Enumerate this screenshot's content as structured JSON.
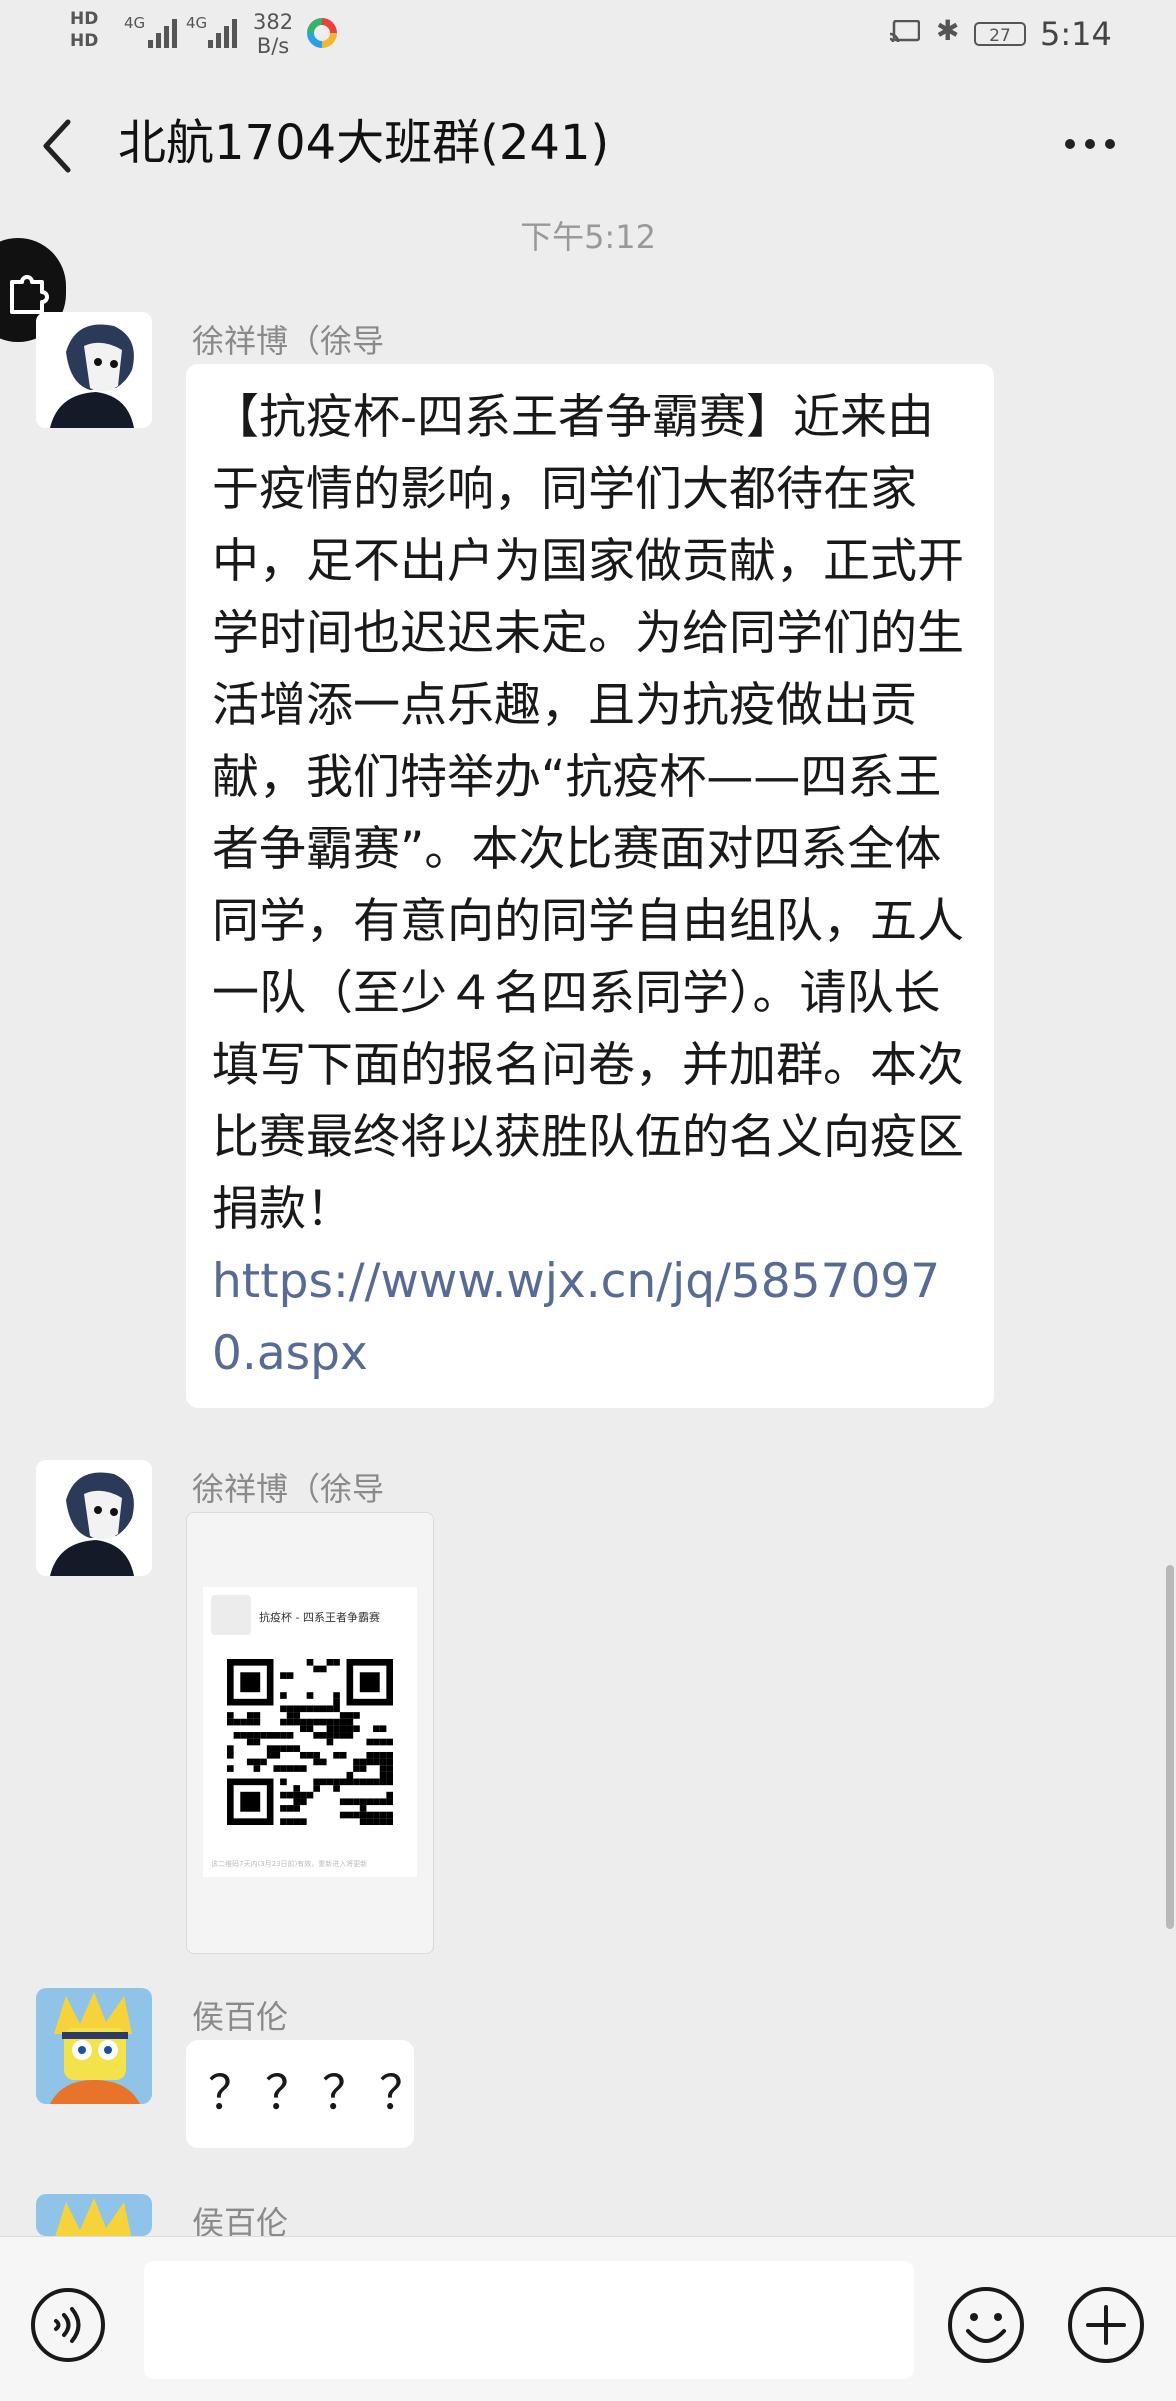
{
  "status_bar": {
    "hd_top": "HD",
    "hd_bottom": "HD",
    "signal1": "4G",
    "signal2": "4G",
    "net_speed_value": "382",
    "net_speed_unit": "B/s",
    "battery": "27",
    "time": "5:14"
  },
  "header": {
    "title": "北航1704大班群(241)"
  },
  "chat": {
    "timestamp": "下午5:12",
    "messages": [
      {
        "sender": "徐祥博（徐导",
        "text": "【抗疫杯-四系王者争霸赛】近来由于疫情的影响，同学们大都待在家中，足不出户为国家做贡献，正式开学时间也迟迟未定。为给同学们的生活增添一点乐趣，且为抗疫做出贡献，我们特举办“抗疫杯——四系王者争霸赛”。本次比赛面对四系全体同学，有意向的同学自由组队，五人一队（至少４名四系同学）。请队长填写下面的报名问卷，并加群。本次比赛最终将以获胜队伍的名义向疫区捐款！",
        "link": "https://www.wjx.cn/jq/58570970.aspx"
      },
      {
        "sender": "徐祥博（徐导",
        "image_title": "抗疫杯 - 四系王者争霸赛",
        "image_footer": "该二维码7天内(3月23日前)有效，重新进入将更新"
      },
      {
        "sender": "侯百伦",
        "text": "？？？？"
      },
      {
        "sender": "侯百伦"
      }
    ]
  },
  "input_bar": {
    "placeholder": ""
  },
  "icons": {
    "back": "chevron-left-icon",
    "more": "more-dots-icon",
    "voice": "voice-icon",
    "emoji": "emoji-icon",
    "plus": "plus-icon"
  }
}
